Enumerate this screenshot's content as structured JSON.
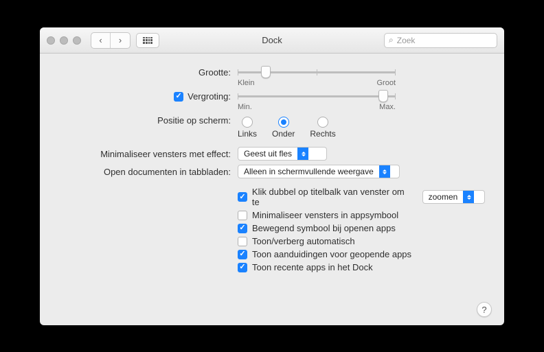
{
  "window": {
    "title": "Dock"
  },
  "toolbar": {
    "search_placeholder": "Zoek"
  },
  "sliders": {
    "size": {
      "label": "Grootte:",
      "min_label": "Klein",
      "max_label": "Groot",
      "value_pct": 18
    },
    "magnify": {
      "label": "Vergroting:",
      "enabled": true,
      "min_label": "Min.",
      "max_label": "Max.",
      "value_pct": 92
    }
  },
  "position": {
    "label": "Positie op scherm:",
    "options": [
      "Links",
      "Onder",
      "Rechts"
    ],
    "selected_index": 1
  },
  "minimize_effect": {
    "label": "Minimaliseer vensters met effect:",
    "value": "Geest uit fles"
  },
  "open_docs_tabs": {
    "label": "Open documenten in tabbladen:",
    "value": "Alleen in schermvullende weergave"
  },
  "checks": {
    "double_click_titlebar": {
      "checked": true,
      "label": "Klik dubbel op titelbalk van venster om te",
      "dropdown": "zoomen"
    },
    "min_in_icon": {
      "checked": false,
      "label": "Minimaliseer vensters in appsymbool"
    },
    "animate_open": {
      "checked": true,
      "label": "Bewegend symbool bij openen apps"
    },
    "autohide": {
      "checked": false,
      "label": "Toon/verberg automatisch"
    },
    "indicators": {
      "checked": true,
      "label": "Toon aanduidingen voor geopende apps"
    },
    "recent_apps": {
      "checked": true,
      "label": "Toon recente apps in het Dock"
    }
  },
  "help": {
    "label": "?"
  }
}
